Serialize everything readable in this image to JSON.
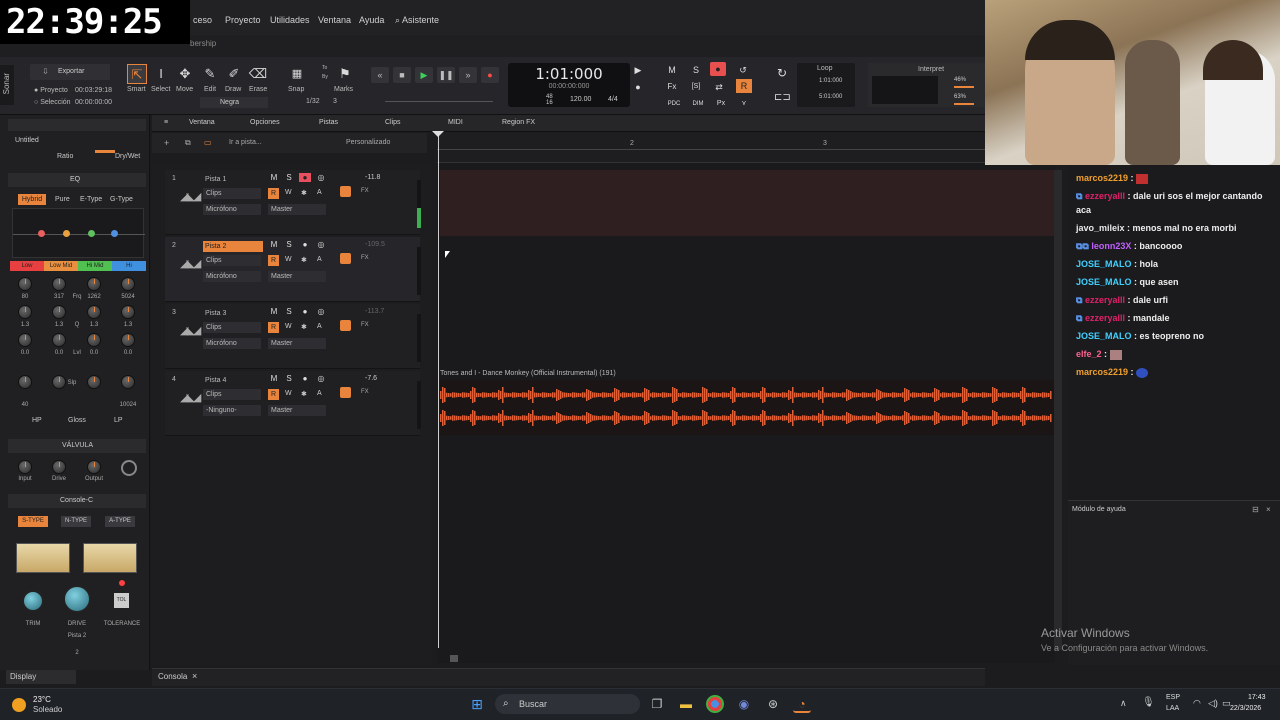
{
  "clock": "22:39:25",
  "menu": [
    "ceso",
    "Proyecto",
    "Utilidades",
    "Ventana",
    "Ayuda",
    "Asistente"
  ],
  "subbar_text": "bership",
  "app_label": "Sonar",
  "toolbar": {
    "export": "Exportar",
    "project_label": "Proyecto",
    "project_time": "00:03:29:18",
    "selection_label": "Selección",
    "selection_time": "00:00:00:00",
    "tools": [
      "Smart",
      "Select",
      "Move",
      "Edit",
      "Draw",
      "Erase"
    ],
    "color_select": "Negra",
    "snap": "Snap",
    "snap_to": "To",
    "snap_by": "By",
    "snap_val": "1/32",
    "snap_num": "3",
    "marks": "Marks",
    "time_big": "1:01:000",
    "time_small": "00:00:00:000",
    "tempo_top": "48",
    "tempo_bottom": "16",
    "bpm": "120.00",
    "meter": "4/4",
    "loop": "Loop",
    "loop_start": "1:01:000",
    "loop_end": "5:01:000",
    "interpret": "Interpret",
    "pct1": "46%",
    "pct2": "63%"
  },
  "inspector": {
    "project": "Untitled",
    "ratio": "Ratio",
    "drywet": "Dry/Wet",
    "eq": "EQ",
    "eq_modes": [
      "Hybrid",
      "Pure",
      "E-Type",
      "G-Type"
    ],
    "bands": [
      "Low",
      "Low Mid",
      "Hi Mid",
      "Hi"
    ],
    "knob_vals_row1": [
      "80",
      "317",
      "1262",
      "5024"
    ],
    "frq": "Frq",
    "q_vals": [
      "1.3",
      "1.3",
      "1.3",
      "1.3"
    ],
    "q": "Q",
    "lvl_vals": [
      "0.0",
      "0.0",
      "0.0",
      "0.0"
    ],
    "lvl": "Lvl",
    "slp": "Slp",
    "hp_val": "40",
    "lp_val": "10024",
    "hp": "HP",
    "gloss": "Gloss",
    "lp": "LP",
    "valve": "VÁLVULA",
    "valve_knobs": [
      "Input",
      "Drive",
      "Output"
    ],
    "console": "Console-C",
    "console_types": [
      "S-TYPE",
      "N-TYPE",
      "A-TYPE"
    ],
    "console_knobs": [
      "TRIM",
      "DRIVE",
      "TOLERANCE"
    ],
    "tol": "TOL",
    "track_name": "Pista 2",
    "track_num": "2"
  },
  "trackbar": {
    "menus": [
      "Ventana",
      "Opciones",
      "Pistas",
      "Clips",
      "MIDI",
      "Region FX"
    ],
    "goto": "Ir a pista...",
    "custom": "Personalizado"
  },
  "ruler_marks": [
    "2",
    "3"
  ],
  "tracks": [
    {
      "num": "1",
      "name": "Pista 1",
      "val": "-11.8",
      "clips": "Clips",
      "input": "Micrófono",
      "output": "Master",
      "selected": false
    },
    {
      "num": "2",
      "name": "Pista 2",
      "val": "-109.5",
      "clips": "Clips",
      "input": "Micrófono",
      "output": "Master",
      "selected": true
    },
    {
      "num": "3",
      "name": "Pista 3",
      "val": "-113.7",
      "clips": "Clips",
      "input": "Micrófono",
      "output": "Master",
      "selected": false
    },
    {
      "num": "4",
      "name": "Pista 4",
      "val": "-7.6",
      "clips": "Clips",
      "input": "-Ninguno-",
      "output": "Master",
      "selected": false
    }
  ],
  "track_btns": {
    "m": "M",
    "s": "S",
    "r": "R",
    "w": "W",
    "a": "A",
    "fx": "FX"
  },
  "clip_title": "Tones and I - Dance Monkey (Official Instrumental) (191)",
  "chat": [
    {
      "user": "marcos2219",
      "msg": "",
      "color": "#f0a030"
    },
    {
      "user": "ezzeryalll",
      "msg": "dale uri sos el mejor cantando aca",
      "color": "#e0206a"
    },
    {
      "user": "javo_mileix",
      "msg": "menos mal no era morbi",
      "color": "#e8e8e8"
    },
    {
      "user": "leonn23X",
      "msg": "bancoooo",
      "color": "#c060ff"
    },
    {
      "user": "JOSE_MALO",
      "msg": "hola",
      "color": "#40d0ff"
    },
    {
      "user": "JOSE_MALO",
      "msg": "que asen",
      "color": "#40d0ff"
    },
    {
      "user": "ezzeryalll",
      "msg": "dale urfi",
      "color": "#e0206a"
    },
    {
      "user": "ezzeryalll",
      "msg": "mandale",
      "color": "#e0206a"
    },
    {
      "user": "JOSE_MALO",
      "msg": "es teopreno no",
      "color": "#40d0ff"
    },
    {
      "user": "elfe_2",
      "msg": "",
      "color": "#ff6090"
    },
    {
      "user": "marcos2219",
      "msg": "",
      "color": "#f0a030"
    }
  ],
  "help_module": "Módulo de ayuda",
  "activate_title": "Activar Windows",
  "activate_sub": "Ve a Configuración para activar Windows.",
  "console_tab": "Consola",
  "display_select": "Display",
  "taskbar": {
    "temp": "23°C",
    "weather": "Soleado",
    "search": "Buscar",
    "lang_top": "ESP",
    "lang_bottom": "LAA",
    "time": "17:43",
    "date": "22/3/2026"
  },
  "colors": {
    "accent": "#e8843c",
    "record": "#ff4a4a"
  }
}
